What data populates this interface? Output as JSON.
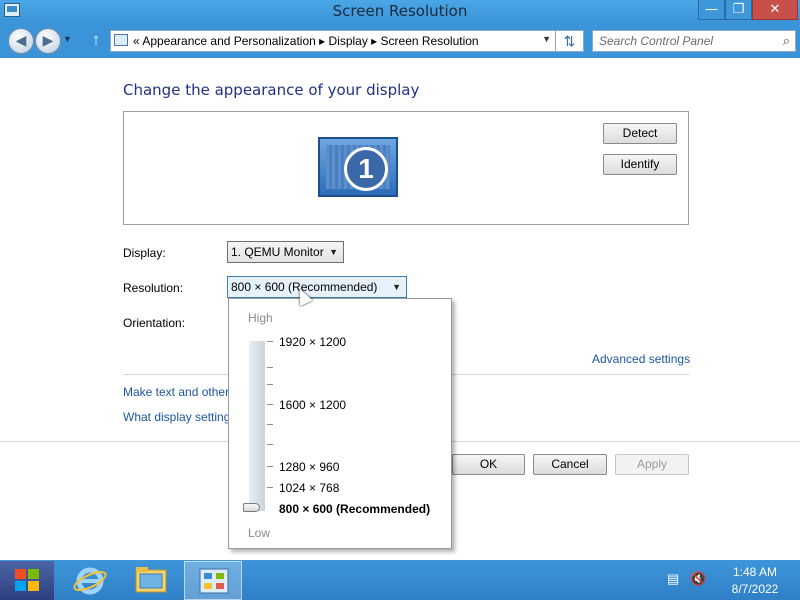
{
  "window": {
    "title": "Screen Resolution",
    "controls": {
      "minimize": "—",
      "maximize": "❐",
      "close": "✕"
    }
  },
  "nav": {
    "back_icon": "back-arrow-icon",
    "forward_icon": "forward-arrow-icon",
    "breadcrumb": "« Appearance and Personalization  ▸  Display  ▸  Screen Resolution",
    "search_placeholder": "Search Control Panel"
  },
  "main": {
    "heading": "Change the appearance of your display",
    "monitor_number": "1",
    "detect_label": "Detect",
    "identify_label": "Identify",
    "display_label": "Display:",
    "display_value": "1. QEMU Monitor",
    "resolution_label": "Resolution:",
    "resolution_value": "800 × 600 (Recommended)",
    "orientation_label": "Orientation:",
    "advanced_link": "Advanced settings",
    "text_link": "Make text and other",
    "display_settings_link": "What display setting",
    "ok_label": "OK",
    "cancel_label": "Cancel",
    "apply_label": "Apply"
  },
  "resolution_popup": {
    "high_label": "High",
    "low_label": "Low",
    "items": [
      {
        "label": "1920 × 1200"
      },
      {
        "label": "1600 × 1200"
      },
      {
        "label": "1280 × 960"
      },
      {
        "label": "1024 × 768"
      },
      {
        "label": "800 × 600 (Recommended)"
      }
    ],
    "selected_index": 4
  },
  "taskbar": {
    "time": "1:48 AM",
    "date": "8/7/2022",
    "apps": [
      "internet-explorer-icon",
      "file-explorer-icon",
      "control-panel-icon"
    ]
  },
  "colors": {
    "titlebar": "#3b93d8",
    "link": "#1d56a5",
    "heading": "#1e3287",
    "taskbar": "#2f80c6"
  }
}
